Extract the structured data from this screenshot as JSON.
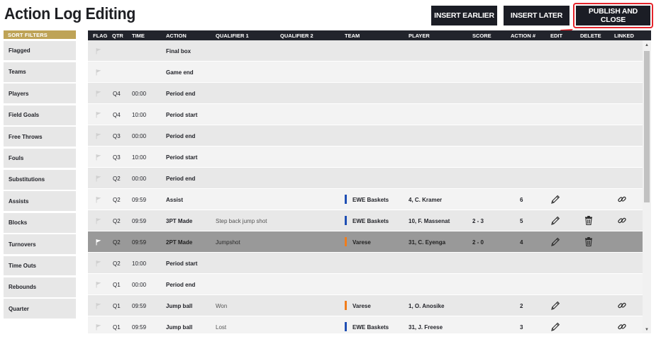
{
  "title": "Action Log Editing",
  "buttons": {
    "insert_earlier": "INSERT EARLIER",
    "insert_later": "INSERT LATER",
    "publish_close": "PUBLISH AND CLOSE"
  },
  "colors": {
    "header_bg": "#22242c",
    "button_bg": "#1b1d25",
    "sidebar_header": "#bea356",
    "highlight": "#e5242b",
    "team_blue": "#1f4fb4",
    "team_orange": "#f07d1c",
    "selected_row": "#999999"
  },
  "sidebar": {
    "header": "SORT FILTERS",
    "items": [
      {
        "label": "Flagged"
      },
      {
        "label": "Teams"
      },
      {
        "label": "Players"
      },
      {
        "label": "Field Goals"
      },
      {
        "label": "Free Throws"
      },
      {
        "label": "Fouls"
      },
      {
        "label": "Substitutions"
      },
      {
        "label": "Assists"
      },
      {
        "label": "Blocks"
      },
      {
        "label": "Turnovers"
      },
      {
        "label": "Time Outs"
      },
      {
        "label": "Rebounds"
      },
      {
        "label": "Quarter"
      }
    ]
  },
  "table": {
    "columns": {
      "flag": "FLAG",
      "qtr": "QTR",
      "time": "TIME",
      "action": "ACTION",
      "qualifier1": "QUALIFIER 1",
      "qualifier2": "QUALIFIER 2",
      "team": "TEAM",
      "player": "PLAYER",
      "score": "SCORE",
      "action_num": "ACTION #",
      "edit": "EDIT",
      "delete": "DELETE",
      "linked": "LINKED"
    },
    "rows": [
      {
        "qtr": "",
        "time": "",
        "action": "Final box",
        "qualifier1": "",
        "team": "",
        "team_color": "",
        "player": "",
        "score": "",
        "action_num": "",
        "edit": false,
        "delete": false,
        "linked": false,
        "selected": false
      },
      {
        "qtr": "",
        "time": "",
        "action": "Game end",
        "qualifier1": "",
        "team": "",
        "team_color": "",
        "player": "",
        "score": "",
        "action_num": "",
        "edit": false,
        "delete": false,
        "linked": false,
        "selected": false
      },
      {
        "qtr": "Q4",
        "time": "00:00",
        "action": "Period end",
        "qualifier1": "",
        "team": "",
        "team_color": "",
        "player": "",
        "score": "",
        "action_num": "",
        "edit": false,
        "delete": false,
        "linked": false,
        "selected": false
      },
      {
        "qtr": "Q4",
        "time": "10:00",
        "action": "Period start",
        "qualifier1": "",
        "team": "",
        "team_color": "",
        "player": "",
        "score": "",
        "action_num": "",
        "edit": false,
        "delete": false,
        "linked": false,
        "selected": false
      },
      {
        "qtr": "Q3",
        "time": "00:00",
        "action": "Period end",
        "qualifier1": "",
        "team": "",
        "team_color": "",
        "player": "",
        "score": "",
        "action_num": "",
        "edit": false,
        "delete": false,
        "linked": false,
        "selected": false
      },
      {
        "qtr": "Q3",
        "time": "10:00",
        "action": "Period start",
        "qualifier1": "",
        "team": "",
        "team_color": "",
        "player": "",
        "score": "",
        "action_num": "",
        "edit": false,
        "delete": false,
        "linked": false,
        "selected": false
      },
      {
        "qtr": "Q2",
        "time": "00:00",
        "action": "Period end",
        "qualifier1": "",
        "team": "",
        "team_color": "",
        "player": "",
        "score": "",
        "action_num": "",
        "edit": false,
        "delete": false,
        "linked": false,
        "selected": false
      },
      {
        "qtr": "Q2",
        "time": "09:59",
        "action": "Assist",
        "qualifier1": "",
        "team": "EWE Baskets",
        "team_color": "#1f4fb4",
        "player": "4, C. Kramer",
        "score": "",
        "action_num": "6",
        "edit": true,
        "delete": false,
        "linked": true,
        "selected": false
      },
      {
        "qtr": "Q2",
        "time": "09:59",
        "action": "3PT Made",
        "qualifier1": "Step back jump shot",
        "team": "EWE Baskets",
        "team_color": "#1f4fb4",
        "player": "10, F. Massenat",
        "score": "2 - 3",
        "action_num": "5",
        "edit": true,
        "delete": true,
        "linked": true,
        "selected": false
      },
      {
        "qtr": "Q2",
        "time": "09:59",
        "action": "2PT Made",
        "qualifier1": "Jumpshot",
        "team": "Varese",
        "team_color": "#f07d1c",
        "player": "31, C. Eyenga",
        "score": "2 - 0",
        "action_num": "4",
        "edit": true,
        "delete": true,
        "linked": false,
        "selected": true
      },
      {
        "qtr": "Q2",
        "time": "10:00",
        "action": "Period start",
        "qualifier1": "",
        "team": "",
        "team_color": "",
        "player": "",
        "score": "",
        "action_num": "",
        "edit": false,
        "delete": false,
        "linked": false,
        "selected": false
      },
      {
        "qtr": "Q1",
        "time": "00:00",
        "action": "Period end",
        "qualifier1": "",
        "team": "",
        "team_color": "",
        "player": "",
        "score": "",
        "action_num": "",
        "edit": false,
        "delete": false,
        "linked": false,
        "selected": false
      },
      {
        "qtr": "Q1",
        "time": "09:59",
        "action": "Jump ball",
        "qualifier1": "Won",
        "team": "Varese",
        "team_color": "#f07d1c",
        "player": "1, O. Anosike",
        "score": "",
        "action_num": "2",
        "edit": true,
        "delete": false,
        "linked": true,
        "selected": false
      },
      {
        "qtr": "Q1",
        "time": "09:59",
        "action": "Jump ball",
        "qualifier1": "Lost",
        "team": "EWE Baskets",
        "team_color": "#1f4fb4",
        "player": "31, J. Freese",
        "score": "",
        "action_num": "3",
        "edit": true,
        "delete": false,
        "linked": true,
        "selected": false
      }
    ]
  },
  "icons": {
    "flag": "flag-icon",
    "edit": "pencil-icon",
    "delete": "trash-icon",
    "linked": "link-icon"
  }
}
